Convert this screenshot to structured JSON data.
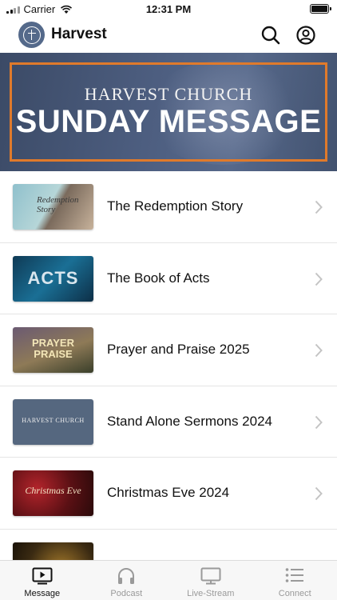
{
  "status_bar": {
    "carrier": "Carrier",
    "time": "12:31 PM",
    "battery_level": 1.0
  },
  "header": {
    "title": "Harvest",
    "logo_icon": "cross-circle-icon",
    "search_icon": "search-icon",
    "profile_icon": "user-circle-icon"
  },
  "hero": {
    "subtitle": "HARVEST CHURCH",
    "title": "SUNDAY MESSAGE",
    "frame_color": "#e07a2b"
  },
  "series": [
    {
      "title": "The Redemption Story",
      "thumb_text": "Redemption Story"
    },
    {
      "title": "The Book of Acts",
      "thumb_text": "ACTS"
    },
    {
      "title": "Prayer and Praise 2025",
      "thumb_text": "PRAYER PRAISE"
    },
    {
      "title": "Stand Alone Sermons 2024",
      "thumb_text": "HARVEST CHURCH"
    },
    {
      "title": "Christmas Eve 2024",
      "thumb_text": "Christmas Eve"
    },
    {
      "title": "",
      "thumb_text": ""
    }
  ],
  "tabs": [
    {
      "label": "Message",
      "icon": "tv-play-icon",
      "active": true
    },
    {
      "label": "Podcast",
      "icon": "headphones-icon",
      "active": false
    },
    {
      "label": "Live-Stream",
      "icon": "monitor-icon",
      "active": false
    },
    {
      "label": "Connect",
      "icon": "list-icon",
      "active": false
    }
  ]
}
